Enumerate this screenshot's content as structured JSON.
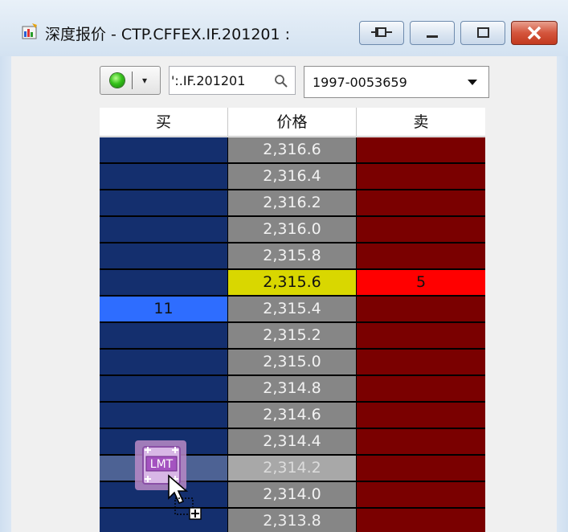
{
  "window": {
    "title": "深度报价 - CTP.CFFEX.IF.201201 :",
    "app_icon": "window-app-icon"
  },
  "toolbar": {
    "connection_status": "connected",
    "status_color": "#2fbf14",
    "symbol_value": "':.IF.201201",
    "account_value": "1997-0053659"
  },
  "ladder": {
    "headers": {
      "bid": "买",
      "price": "价格",
      "ask": "卖"
    },
    "colors": {
      "bid": "#142f6e",
      "price": "#868686",
      "ask": "#7a0000",
      "last_price": "#d9d700",
      "best_ask": "#ff0000",
      "best_bid": "#2e6dff"
    },
    "rows": [
      {
        "bid": "",
        "price": "2,316.6",
        "ask": ""
      },
      {
        "bid": "",
        "price": "2,316.4",
        "ask": ""
      },
      {
        "bid": "",
        "price": "2,316.2",
        "ask": ""
      },
      {
        "bid": "",
        "price": "2,316.0",
        "ask": ""
      },
      {
        "bid": "",
        "price": "2,315.8",
        "ask": ""
      },
      {
        "bid": "",
        "price": "2,315.6",
        "ask": "5"
      },
      {
        "bid": "11",
        "price": "2,315.4",
        "ask": ""
      },
      {
        "bid": "",
        "price": "2,315.2",
        "ask": ""
      },
      {
        "bid": "",
        "price": "2,315.0",
        "ask": ""
      },
      {
        "bid": "",
        "price": "2,314.8",
        "ask": ""
      },
      {
        "bid": "",
        "price": "2,314.6",
        "ask": ""
      },
      {
        "bid": "",
        "price": "2,314.4",
        "ask": ""
      },
      {
        "bid": "",
        "price": "2,314.2",
        "ask": ""
      },
      {
        "bid": "",
        "price": "2,314.0",
        "ask": ""
      },
      {
        "bid": "",
        "price": "2,313.8",
        "ask": ""
      }
    ]
  },
  "drag_order": {
    "label": "LMT",
    "icon": "limit-order-icon",
    "cursor": "drag-copy-cursor-icon"
  }
}
